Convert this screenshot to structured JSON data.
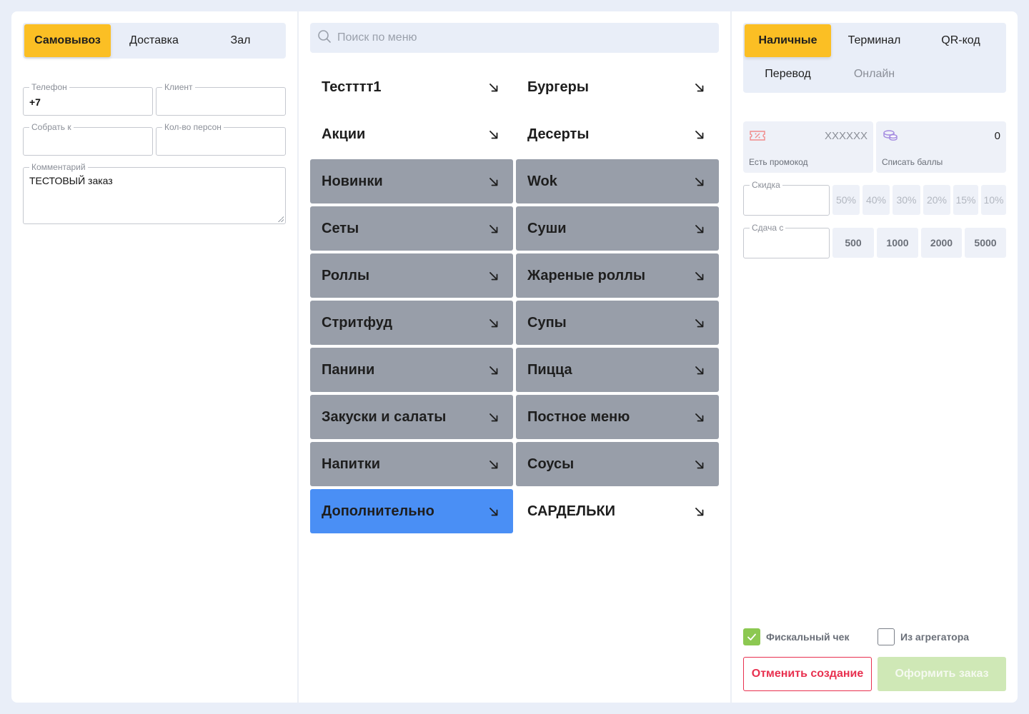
{
  "order_type": {
    "options": [
      "Самовывоз",
      "Доставка",
      "Зал"
    ],
    "selected": "Самовывоз"
  },
  "form": {
    "phone": {
      "label": "Телефон",
      "value": "+7"
    },
    "client": {
      "label": "Клиент",
      "value": ""
    },
    "collect_by": {
      "label": "Собрать к",
      "value": ""
    },
    "persons": {
      "label": "Кол-во персон",
      "value": ""
    },
    "comment": {
      "label": "Комментарий",
      "value": "ТЕСТОВЫЙ заказ"
    }
  },
  "search": {
    "placeholder": "Поиск по меню"
  },
  "categories": [
    {
      "label": "Тестттт1",
      "style": "plain"
    },
    {
      "label": "Бургеры",
      "style": "plain"
    },
    {
      "label": "Акции",
      "style": "plain"
    },
    {
      "label": "Десерты",
      "style": "plain"
    },
    {
      "label": "Новинки",
      "style": "gray"
    },
    {
      "label": "Wok",
      "style": "gray"
    },
    {
      "label": "Сеты",
      "style": "gray"
    },
    {
      "label": "Суши",
      "style": "gray"
    },
    {
      "label": "Роллы",
      "style": "gray"
    },
    {
      "label": "Жареные роллы",
      "style": "gray"
    },
    {
      "label": "Стритфуд",
      "style": "gray"
    },
    {
      "label": "Супы",
      "style": "gray"
    },
    {
      "label": "Панини",
      "style": "gray"
    },
    {
      "label": "Пицца",
      "style": "gray"
    },
    {
      "label": "Закуски и салаты",
      "style": "gray"
    },
    {
      "label": "Постное меню",
      "style": "gray"
    },
    {
      "label": "Напитки",
      "style": "gray"
    },
    {
      "label": "Соусы",
      "style": "gray"
    },
    {
      "label": "Дополнительно",
      "style": "blue"
    },
    {
      "label": "САРДЕЛЬКИ",
      "style": "plain"
    }
  ],
  "payment": {
    "options": [
      "Наличные",
      "Терминал",
      "QR-код",
      "Перевод",
      "Онлайн"
    ],
    "selected": "Наличные",
    "disabled": [
      "Онлайн"
    ]
  },
  "promo": {
    "label": "Есть промокод",
    "placeholder": "XXXXXX"
  },
  "points": {
    "label": "Списать баллы",
    "value": "0"
  },
  "discount": {
    "label": "Скидка",
    "options": [
      "50%",
      "40%",
      "30%",
      "20%",
      "15%",
      "10%"
    ]
  },
  "change": {
    "label": "Сдача с",
    "options": [
      "500",
      "1000",
      "2000",
      "5000"
    ]
  },
  "checkboxes": {
    "fiscal": {
      "label": "Фискальный чек",
      "checked": true
    },
    "aggregator": {
      "label": "Из агрегатора",
      "checked": false
    }
  },
  "actions": {
    "cancel": "Отменить создание",
    "submit": "Оформить заказ"
  },
  "colors": {
    "accent": "#fbbf24",
    "category_gray": "#989ea9",
    "category_active": "#4a8ff5",
    "success": "#8cc851",
    "danger": "#e8304f"
  }
}
